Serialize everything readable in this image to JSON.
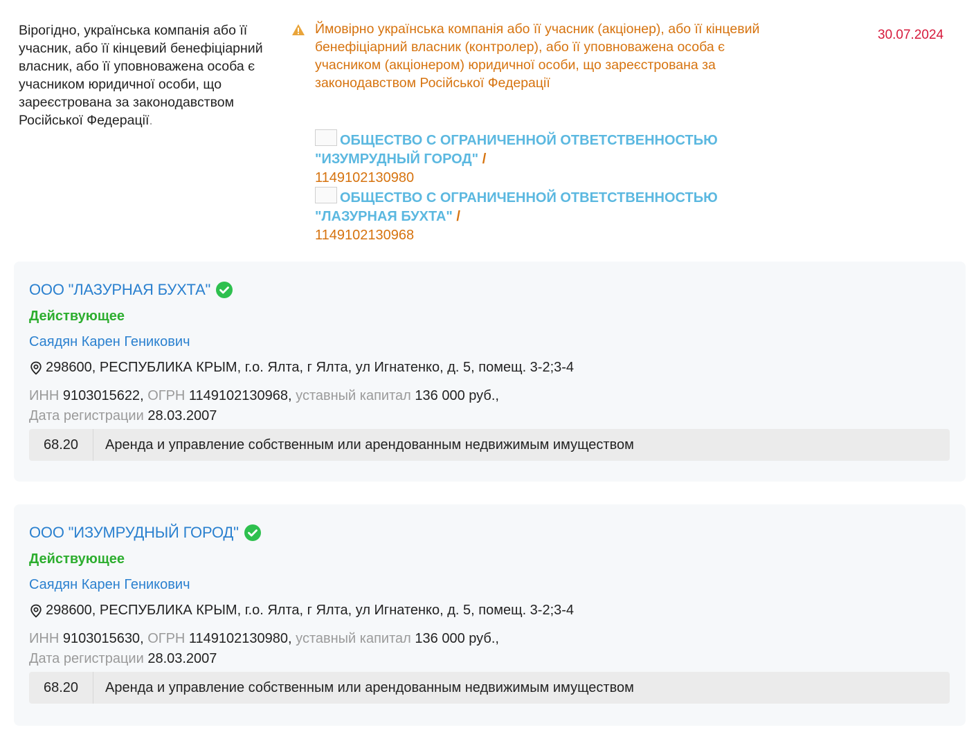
{
  "risk": {
    "description": "Вірогідно, українська компанія або її учасник, або її кінцевий бенефіціарний власник, або її уповноважена особа є учасником юридичної особи, що зареєстрована за законодавством Російської Федерації",
    "description_dot": ".",
    "detail": "Ймовірно українська компанія або її учасник (акціонер), або її кінцевий бенефіціарний власник (контролер), або її уповноважена особа є учасником (акціонером) юридичної особи, що зареєстрована за законодавством Російської Федерації",
    "date": "30.07.2024",
    "warning_icon": "warning-triangle-icon",
    "warning_color": "#e9a43a",
    "linked_entities": [
      {
        "name": "ОБЩЕСТВО С ОГРАНИЧЕННОЙ ОТВЕТСТВЕННОСТЬЮ \"ИЗУМРУДНЫЙ ГОРОД\"",
        "separator": " /",
        "ogrn": "1149102130980"
      },
      {
        "name": "ОБЩЕСТВО С ОГРАНИЧЕННОЙ ОТВЕТСТВЕННОСТЬЮ \"ЛАЗУРНАЯ БУХТА\"",
        "separator": " /",
        "ogrn": "1149102130968"
      }
    ]
  },
  "companies": [
    {
      "title": "ООО \"ЛАЗУРНАЯ БУХТА\"",
      "status": "Действующее",
      "person": "Саядян Карен Геникович",
      "address": "298600, РЕСПУБЛИКА КРЫМ, г.о. Ялта, г Ялта, ул Игнатенко, д. 5, помещ. 3-2;3-4",
      "inn_label": "ИНН",
      "inn": "9103015622",
      "ogrn_label": "ОГРН",
      "ogrn": "1149102130968",
      "capital_label": "уставный капитал",
      "capital": "136 000 руб.",
      "reg_label": "Дата регистрации",
      "reg_date": "28.03.2007",
      "okved_code": "68.20",
      "okved_name": "Аренда и управление собственным или арендованным недвижимым имуществом"
    },
    {
      "title": "ООО \"ИЗУМРУДНЫЙ ГОРОД\"",
      "status": "Действующее",
      "person": "Саядян Карен Геникович",
      "address": "298600, РЕСПУБЛИКА КРЫМ, г.о. Ялта, г Ялта, ул Игнатенко, д. 5, помещ. 3-2;3-4",
      "inn_label": "ИНН",
      "inn": "9103015630",
      "ogrn_label": "ОГРН",
      "ogrn": "1149102130980",
      "capital_label": "уставный капитал",
      "capital": "136 000 руб.",
      "reg_label": "Дата регистрации",
      "reg_date": "28.03.2007",
      "okved_code": "68.20",
      "okved_name": "Аренда и управление собственным или арендованным недвижимым имуществом"
    }
  ],
  "colors": {
    "link": "#2a80cf",
    "status_active": "#2dae2f",
    "warning_text": "#d6730f",
    "date": "#d6193b",
    "linked_name": "#5bb8e0",
    "verified": "#2ec04e"
  },
  "icons": {
    "verified": "check-circle-icon",
    "address": "location-pin-icon"
  }
}
